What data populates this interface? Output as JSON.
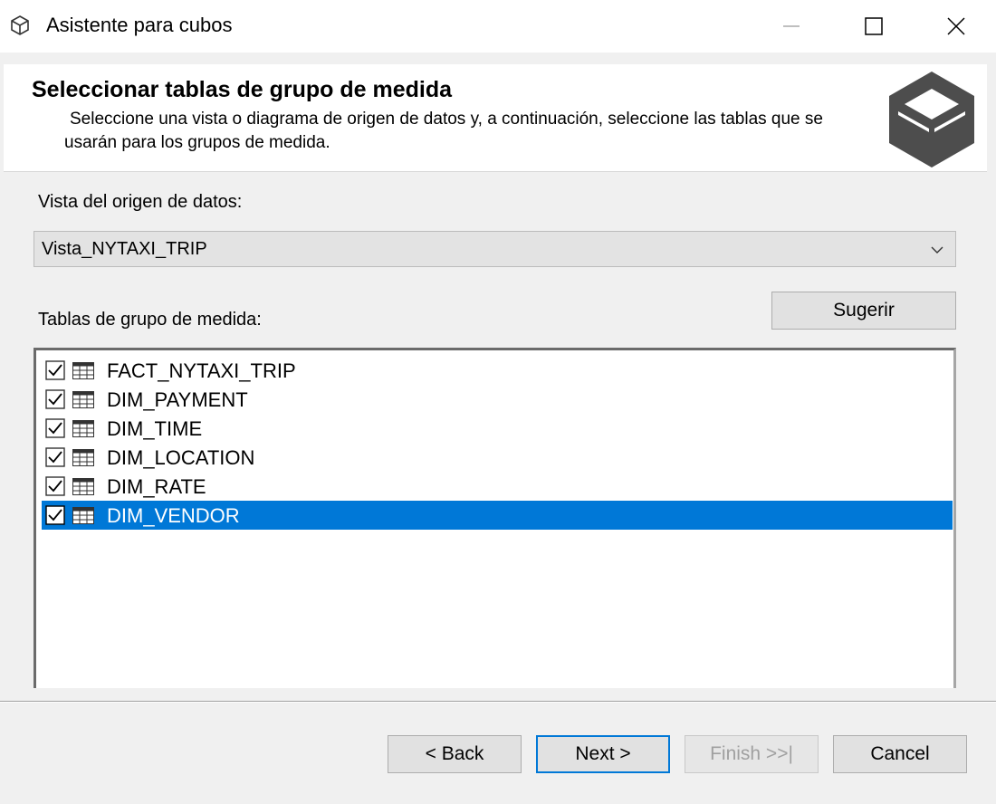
{
  "window": {
    "title": "Asistente para cubos",
    "app_icon": "cube-icon",
    "controls": [
      "minimize-icon",
      "maximize-icon",
      "close-icon"
    ]
  },
  "header": {
    "title": "Seleccionar tablas de grupo de medida",
    "description": "Seleccione una vista o diagrama de origen de datos y, a continuación, seleccione las tablas que se usarán para los grupos de medida.",
    "logo": "cube-icon"
  },
  "datasource": {
    "label": "Vista del origen de datos:",
    "selected": "Vista_NYTAXI_TRIP"
  },
  "measure_tables": {
    "label": "Tablas de grupo de medida:",
    "suggest_label": "Sugerir",
    "items": [
      {
        "name": "FACT_NYTAXI_TRIP",
        "checked": true,
        "selected": false
      },
      {
        "name": "DIM_PAYMENT",
        "checked": true,
        "selected": false
      },
      {
        "name": "DIM_TIME",
        "checked": true,
        "selected": false
      },
      {
        "name": "DIM_LOCATION",
        "checked": true,
        "selected": false
      },
      {
        "name": "DIM_RATE",
        "checked": true,
        "selected": false
      },
      {
        "name": "DIM_VENDOR",
        "checked": true,
        "selected": true
      }
    ]
  },
  "footer": {
    "back_label": "< Back",
    "next_label": "Next >",
    "finish_label": "Finish >>|",
    "cancel_label": "Cancel"
  },
  "colors": {
    "selection": "#0078d7",
    "logo": "#4d4d4d"
  }
}
